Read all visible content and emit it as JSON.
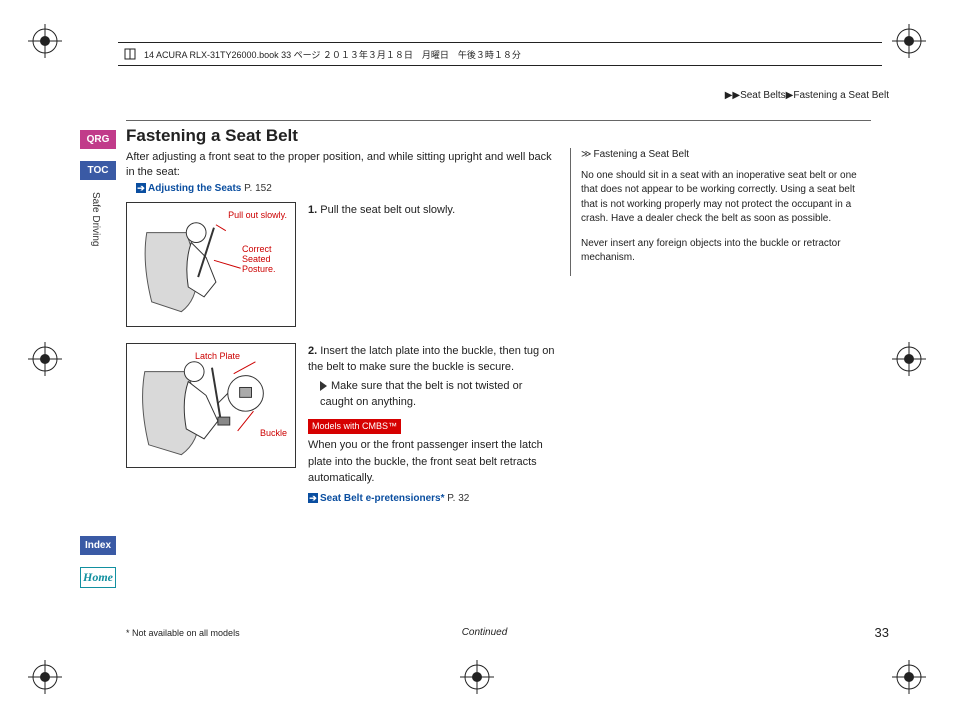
{
  "header_text": "14 ACURA RLX-31TY26000.book  33 ページ  ２０１３年３月１８日　月曜日　午後３時１８分",
  "breadcrumb": {
    "a": "Seat Belts",
    "b": "Fastening a Seat Belt"
  },
  "tabs": {
    "qrg": "QRG",
    "toc": "TOC",
    "index": "Index",
    "home": "Home"
  },
  "vertical_label": "Safe Driving",
  "title": "Fastening a Seat Belt",
  "intro": "After adjusting a front seat to the proper position, and while sitting upright and well back in the seat:",
  "xref1": {
    "label": "Adjusting the Seats",
    "page": "P. 152"
  },
  "fig1": {
    "l1": "Pull out slowly.",
    "l2": "Correct Seated Posture."
  },
  "step1": {
    "num": "1.",
    "text": "Pull the seat belt out slowly."
  },
  "fig2": {
    "l1": "Latch Plate",
    "l2": "Buckle"
  },
  "step2": {
    "num": "2.",
    "text": "Insert the latch plate into the buckle, then tug on the belt to make sure the buckle is secure.",
    "sub": "Make sure that the belt is not twisted or caught on anything."
  },
  "model_tag": "Models with CMBS™",
  "model_text": "When you or the front passenger insert the latch plate into the buckle, the front seat belt retracts automatically.",
  "xref2": {
    "label": "Seat Belt e-pretensioners*",
    "page": "P. 32"
  },
  "side": {
    "head": "Fastening a Seat Belt",
    "p1": "No one should sit in a seat with an inoperative seat belt or one that does not appear to be working correctly. Using a seat belt that is not working properly may not protect the occupant in a crash. Have a dealer check the belt as soon as possible.",
    "p2": "Never insert any foreign objects into the buckle or retractor mechanism."
  },
  "footnote": "* Not available on all models",
  "continued": "Continued",
  "page_num": "33"
}
